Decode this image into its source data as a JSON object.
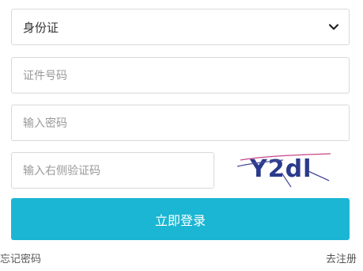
{
  "form": {
    "id_type_select": {
      "value": "身份证"
    },
    "id_number": {
      "placeholder": "证件号码"
    },
    "password": {
      "placeholder": "输入密码"
    },
    "captcha_input": {
      "placeholder": "输入右侧验证码"
    },
    "captcha_image": {
      "text": "Y2dl"
    },
    "login_button": "立即登录"
  },
  "links": {
    "forgot_password": "忘记密码",
    "register": "去注册"
  },
  "colors": {
    "primary_button": "#1bb6d3",
    "captcha_text": "#2a3a8c",
    "captcha_noise": "#c8458a"
  },
  "icons": {
    "select_arrow": "chevron-down-icon"
  }
}
